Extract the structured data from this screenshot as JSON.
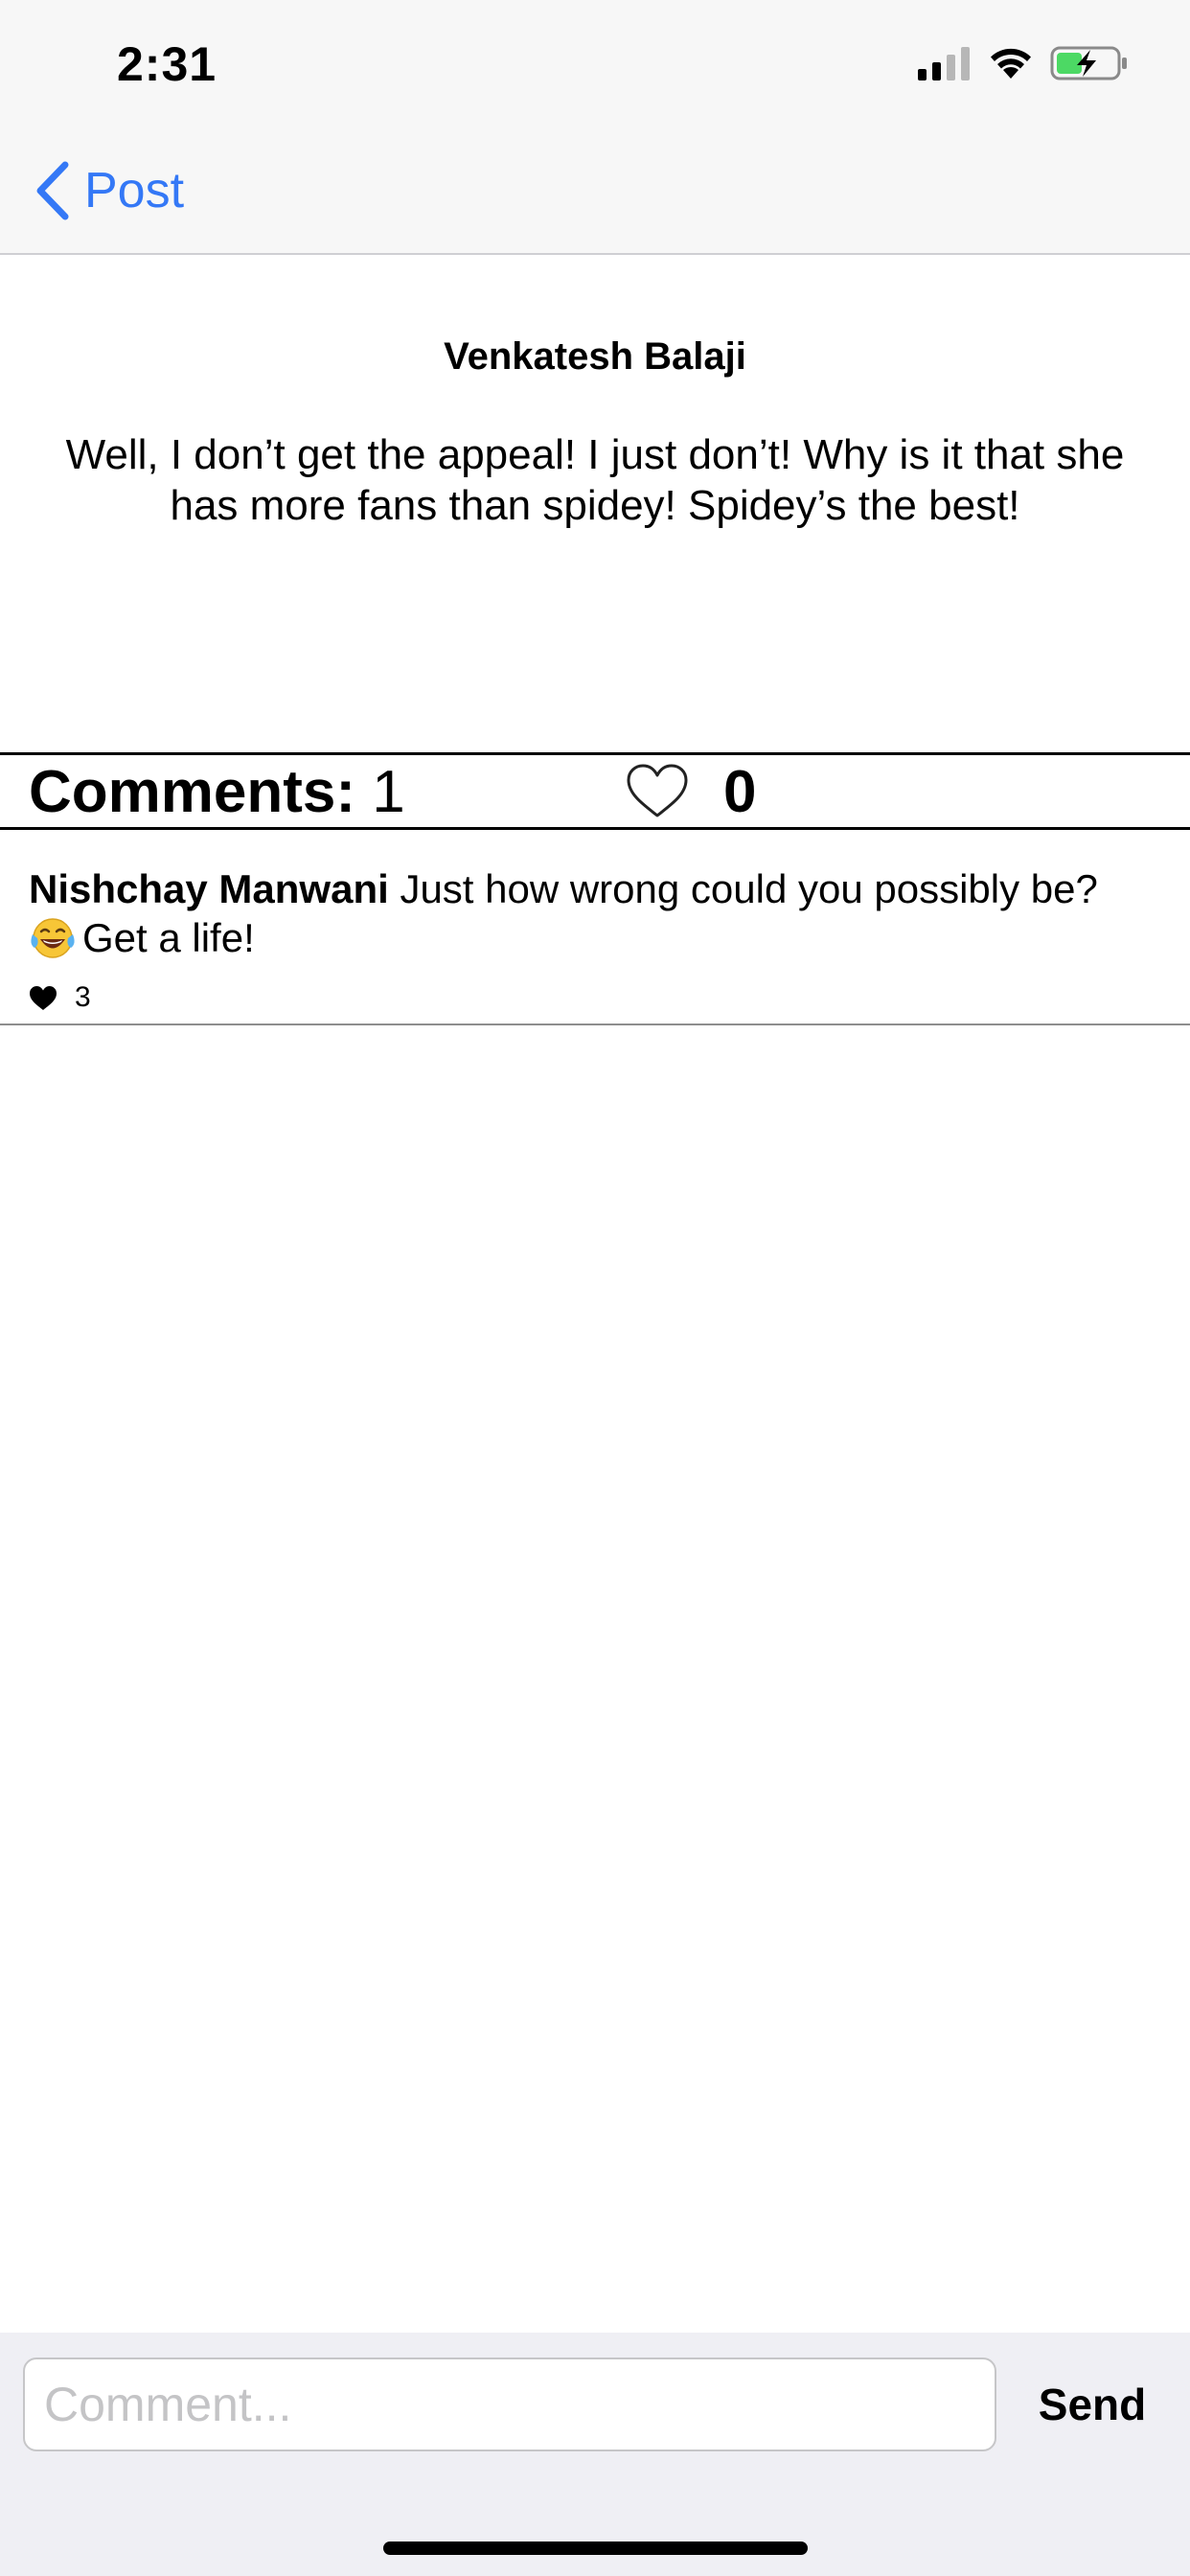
{
  "status_bar": {
    "time": "2:31"
  },
  "nav": {
    "back_label": "Post",
    "accent_color": "#3478f6"
  },
  "post": {
    "author": "Venkatesh Balaji",
    "body": "Well, I don’t get the appeal! I just don’t! Why is it that she has more fans than spidey! Spidey’s the best!"
  },
  "stats": {
    "comments_label": "Comments:",
    "comments_count": "1",
    "likes_count": "0"
  },
  "comments": [
    {
      "author": "Nishchay Manwani",
      "text_line1": "Just how wrong could you possibly be?",
      "emoji": "laughing-tears-emoji",
      "text_line2": "Get a life!",
      "likes": "3"
    }
  ],
  "composer": {
    "placeholder": "Comment...",
    "send_label": "Send"
  },
  "icons": {
    "back": "chevron-left-icon",
    "like": "heart-outline-icon",
    "comment_like": "heart-filled-icon"
  }
}
